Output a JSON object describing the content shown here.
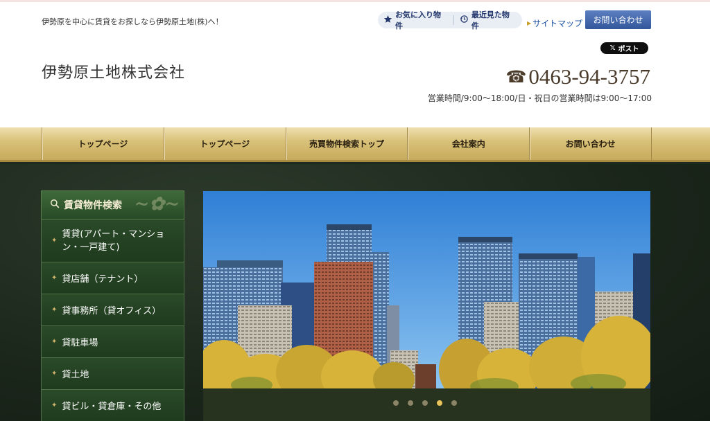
{
  "header": {
    "tagline": "伊勢原を中心に賃貸をお探しなら伊勢原土地(株)へ！",
    "favorites_label": "お気に入り物件",
    "recent_label": "最近見た物件",
    "sitemap_label": "サイトマップ",
    "contact_button": "お問い合わせ",
    "post_button": "ポスト",
    "company_name": "伊勢原土地株式会社",
    "phone": "0463-94-3757",
    "hours": "営業時間/9:00～18:00/日・祝日の営業時間は9:00～17:00"
  },
  "nav": {
    "items": [
      "トップページ",
      "トップページ",
      "売買物件検索トップ",
      "会社案内",
      "お問い合わせ"
    ]
  },
  "sidebar": {
    "title": "賃貸物件検索",
    "items": [
      "賃貸(アパート・マンション・一戸建て)",
      "貸店舗（テナント）",
      "貸事務所（貸オフィス）",
      "貸駐車場",
      "貸土地",
      "貸ビル・貸倉庫・その他"
    ]
  },
  "slider": {
    "slide_count": 5,
    "active_index": 3
  },
  "colors": {
    "nav_gold": "#d9c27a",
    "sidebar_green": "#2a4a28",
    "contact_blue": "#3e63a8",
    "accent_dot": "#e8c45a"
  },
  "icons": {
    "favorites": "star-icon",
    "recent": "history-icon",
    "phone": "phone-icon",
    "search": "search-icon"
  }
}
